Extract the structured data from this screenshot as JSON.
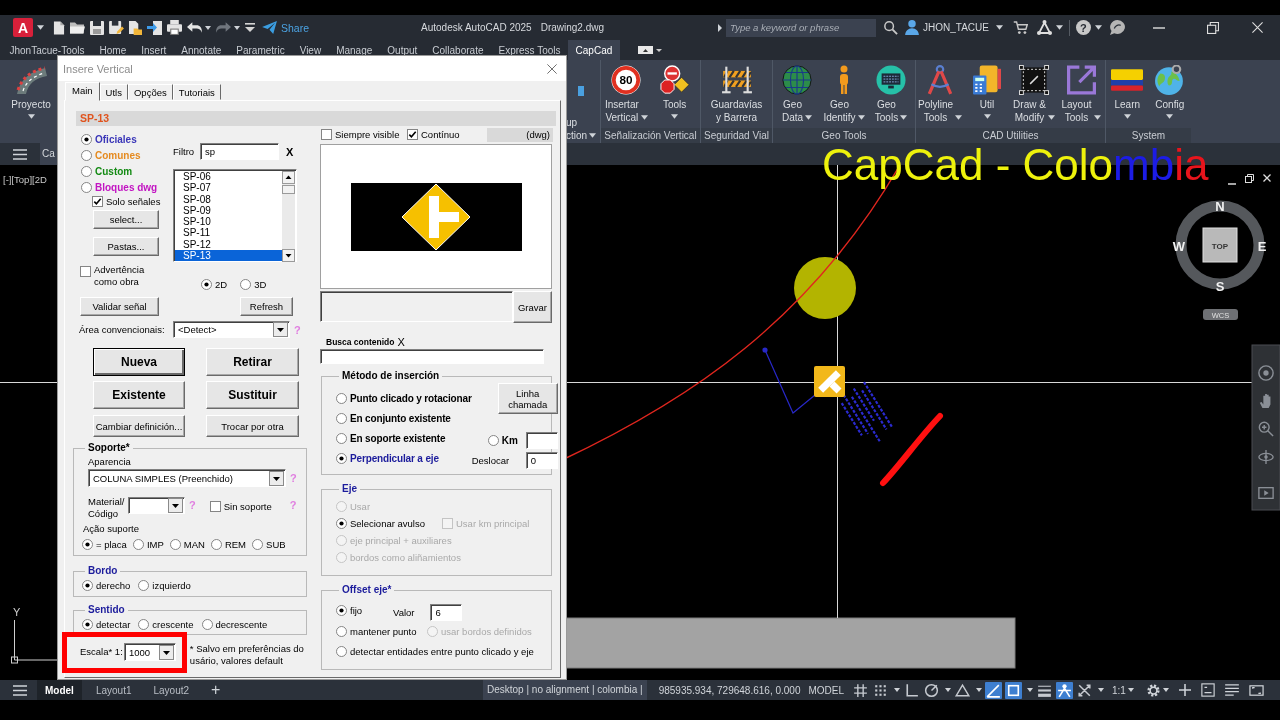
{
  "title_bar": {
    "logo": "A",
    "share": "Share",
    "app_title": "Autodesk AutoCAD 2025",
    "file_name": "Drawing2.dwg",
    "search": {
      "placeholder": "Type a keyword or phrase"
    },
    "user": "JHON_TACUE",
    "help": "?"
  },
  "ribbon_tabs": [
    {
      "label": "JhonTacue-Tools",
      "selected": false
    },
    {
      "label": "Home",
      "selected": false
    },
    {
      "label": "Insert",
      "selected": false
    },
    {
      "label": "Annotate",
      "selected": false
    },
    {
      "label": "Parametric",
      "selected": false
    },
    {
      "label": "View",
      "selected": false
    },
    {
      "label": "Manage",
      "selected": false
    },
    {
      "label": "Output",
      "selected": false
    },
    {
      "label": "Collaborate",
      "selected": false
    },
    {
      "label": "Express Tools",
      "selected": false
    },
    {
      "label": "CapCad",
      "selected": true
    }
  ],
  "ribbon": {
    "first_button": {
      "label": "Proyecto",
      "dropdown": true
    },
    "cut_button": {
      "label": "up\nction",
      "dropdown": true
    },
    "panels": [
      {
        "title": "Señalización Vertical",
        "buttons": [
          {
            "label": "Insertar\nVertical",
            "dropdown": true,
            "icon_text": "80"
          },
          {
            "label": "Tools",
            "dropdown": true
          }
        ]
      },
      {
        "title": "Seguridad Vial",
        "buttons": [
          {
            "label": "Guardavías\ny Barrera",
            "dropdown": false
          }
        ]
      },
      {
        "title": "Geo Tools",
        "buttons": [
          {
            "label": "Geo\nData",
            "dropdown": true
          },
          {
            "label": "Geo\nIdentify",
            "dropdown": true
          },
          {
            "label": "Geo\nTools",
            "dropdown": true
          }
        ]
      },
      {
        "title": "CAD Utilities",
        "buttons": [
          {
            "label": "Polyline\nTools",
            "dropdown": true
          },
          {
            "label": "Util",
            "dropdown": true
          },
          {
            "label": "Draw &\nModify",
            "dropdown": true
          },
          {
            "label": "Layout\nTools",
            "dropdown": true
          }
        ]
      },
      {
        "title": "System",
        "buttons": [
          {
            "label": "Learn",
            "dropdown": true
          },
          {
            "label": "Config",
            "dropdown": true
          }
        ]
      }
    ]
  },
  "overlay_title": [
    {
      "text": "CapCad - Colo",
      "color": "#eef20c"
    },
    {
      "text": "mb",
      "color": "#1c1ce6"
    },
    {
      "text": "ia",
      "color": "#e8141c"
    }
  ],
  "file_tab": "Ca",
  "viewport": {
    "view_label": "[-][Top][2D",
    "viewcube": {
      "north": "N",
      "west": "W",
      "east": "E",
      "south": "S",
      "face": "TOP",
      "ucs": "WCS"
    },
    "axis_label": "Y"
  },
  "dialog": {
    "title": "Insere Vertical",
    "tabs": [
      {
        "label": "Main",
        "selected": true
      },
      {
        "label": "Utls",
        "selected": false
      },
      {
        "label": "Opções",
        "selected": false
      },
      {
        "label": "Tutoriais",
        "selected": false
      }
    ],
    "header": "SP-13",
    "sources": [
      {
        "label": "Oficiales",
        "selected": true,
        "color": "#3a36b8"
      },
      {
        "label": "Comunes",
        "selected": false,
        "color": "#e58a1f"
      },
      {
        "label": "Custom",
        "selected": false,
        "color": "#138a13"
      },
      {
        "label": "Bloques dwg",
        "selected": false,
        "color": "#c214c2"
      }
    ],
    "solo_senales": {
      "label": "Solo señales",
      "checked": true
    },
    "select_button": "select...",
    "folders_button": "Pastas...",
    "filter": {
      "label": "Filtro",
      "value": "sp",
      "clear": "X"
    },
    "sign_list": [
      {
        "label": "SP-06",
        "selected": false
      },
      {
        "label": "SP-07",
        "selected": false
      },
      {
        "label": "SP-08",
        "selected": false
      },
      {
        "label": "SP-09",
        "selected": false
      },
      {
        "label": "SP-10",
        "selected": false
      },
      {
        "label": "SP-11",
        "selected": false
      },
      {
        "label": "SP-12",
        "selected": false
      },
      {
        "label": "SP-13",
        "selected": true
      }
    ],
    "warning_as_work": {
      "label": "Advertência como obra",
      "checked": false
    },
    "dimension": [
      {
        "label": "2D",
        "selected": true
      },
      {
        "label": "3D",
        "selected": false
      }
    ],
    "validate_button": "Validar señal",
    "refresh_button": "Refresh",
    "area": {
      "label": "Área convencionais:",
      "value": "<Detect>",
      "help": "?"
    },
    "actions": [
      {
        "label": "Nueva",
        "kind": "large",
        "default": true
      },
      {
        "label": "Retirar",
        "kind": "large",
        "default": false
      },
      {
        "label": "Existente",
        "kind": "large",
        "default": false
      },
      {
        "label": "Sustituir",
        "kind": "large",
        "default": false
      },
      {
        "label": "Cambiar definición...",
        "kind": "small",
        "default": false
      },
      {
        "label": "Trocar por otra",
        "kind": "small",
        "default": false
      }
    ],
    "support": {
      "title": "Soporte*",
      "appearance_label": "Aparencia",
      "appearance_value": "COLUNA SIMPLES (Preenchido)",
      "appearance_help": "?",
      "material_label": "Material/\nCódigo",
      "material_help": "?",
      "no_support": {
        "label": "Sin soporte",
        "checked": false
      },
      "no_support_help": "?",
      "action_label": "Ação suporte",
      "actions": [
        {
          "label": "= placa",
          "selected": true
        },
        {
          "label": "IMP",
          "selected": false
        },
        {
          "label": "MAN",
          "selected": false
        },
        {
          "label": "REM",
          "selected": false
        },
        {
          "label": "SUB",
          "selected": false
        }
      ]
    },
    "edge": {
      "title": "Bordo",
      "options": [
        {
          "label": "derecho",
          "selected": true
        },
        {
          "label": "izquierdo",
          "selected": false
        }
      ]
    },
    "direction": {
      "title": "Sentido",
      "options": [
        {
          "label": "detectar",
          "selected": true
        },
        {
          "label": "crescente",
          "selected": false
        },
        {
          "label": "decrescente",
          "selected": false
        }
      ]
    },
    "scale": {
      "label": "Escala* 1:",
      "value": "1000"
    },
    "note": "* Salvo em preferências do usário, valores default",
    "always_visible": {
      "label": "Siempre visible",
      "checked": false
    },
    "continuous": {
      "label": "Contínuo",
      "checked": true
    },
    "preview_tag": "(dwg)",
    "save_button": "Gravar",
    "content_search": {
      "label": "Busca contenido",
      "clear": "X"
    },
    "insertion": {
      "title": "Método de inserción",
      "options": [
        {
          "label": "Punto clicado y rotacionar",
          "selected": false
        },
        {
          "label": "En conjunto existente",
          "selected": false
        },
        {
          "label": "En soporte existente",
          "selected": false
        },
        {
          "label": "Perpendicular a eje",
          "selected": true
        }
      ],
      "leader_button": "Linha\nchamada",
      "km": {
        "label": "Km",
        "selected": false
      },
      "offset_label": "Deslocar",
      "offset_value": "0"
    },
    "axis": {
      "title": "Eje",
      "options": [
        {
          "label": "Usar",
          "selected": false,
          "disabled": true
        },
        {
          "label": "Selecionar avulso",
          "selected": true,
          "disabled": false
        },
        {
          "label": "eje principal + auxiliares",
          "selected": false,
          "disabled": true
        },
        {
          "label": "bordos como aliñamientos",
          "selected": false,
          "disabled": true
        }
      ],
      "km_principal": {
        "label": "Usar km principal",
        "checked": false,
        "disabled": true
      }
    },
    "offset": {
      "title": "Offset eje*",
      "value_label": "Valor",
      "value": "6",
      "options": [
        {
          "label": "fijo",
          "selected": true,
          "disabled": false
        },
        {
          "label": "mantener punto",
          "selected": false,
          "disabled": false
        },
        {
          "label": "usar bordos definidos",
          "selected": false,
          "disabled": true
        },
        {
          "label": "detectar entidades entre punto clicado y eje",
          "selected": false,
          "disabled": false
        }
      ]
    }
  },
  "status_bar": {
    "layout_tabs": [
      {
        "label": "Model",
        "selected": true
      },
      {
        "label": "Layout1",
        "selected": false
      },
      {
        "label": "Layout2",
        "selected": false
      }
    ],
    "add_tab": "+",
    "info": "Desktop | no alignment | colombia |",
    "coordinates": "985935.934, 729648.616, 0.000",
    "space": "MODEL",
    "toggles": [
      {
        "on": false
      },
      {
        "on": false
      },
      {
        "on": false
      },
      {
        "on": false
      },
      {
        "on": false
      },
      {
        "on": true
      },
      {
        "on": true
      },
      {
        "on": false
      },
      {
        "on": true
      },
      {
        "on": false
      }
    ],
    "scale": "1:1"
  }
}
